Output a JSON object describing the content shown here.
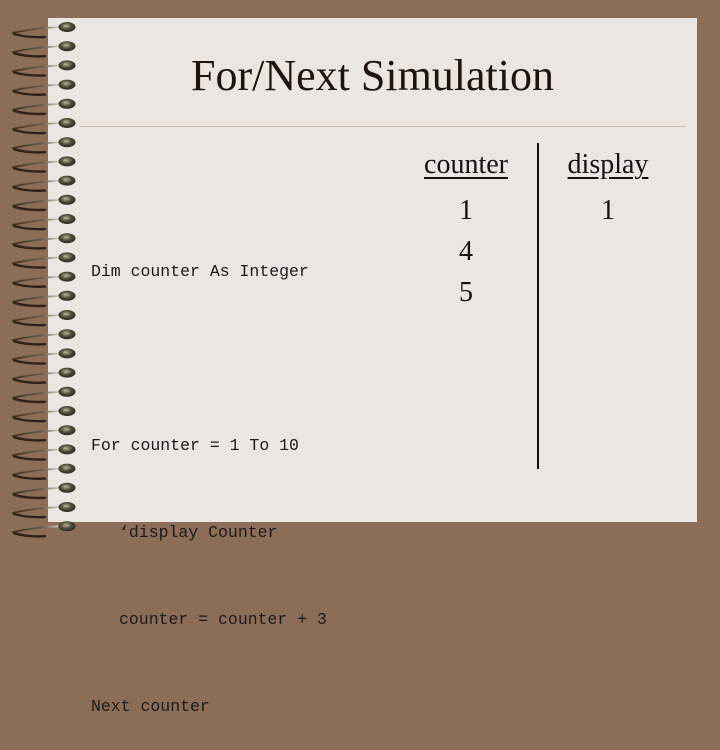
{
  "slide": {
    "title": "For/Next Simulation",
    "code_lines": [
      {
        "text": "Dim counter As Integer",
        "indent": false
      },
      {
        "text": "",
        "indent": false
      },
      {
        "text": "For counter = 1 To 10",
        "indent": false
      },
      {
        "text": "‘display Counter",
        "indent": true
      },
      {
        "text": "counter = counter + 3",
        "indent": true
      },
      {
        "text": "Next counter",
        "indent": false
      }
    ],
    "trace_table": {
      "columns": [
        {
          "header": "counter",
          "values": [
            "1",
            "4",
            "5"
          ]
        },
        {
          "header": "display",
          "values": [
            "1"
          ]
        }
      ]
    }
  },
  "decor": {
    "spiral_icon": "spiral-binding-icon",
    "ring_count": 27
  },
  "colors": {
    "background": "#8c6d58",
    "paper": "#ebe6e1",
    "title_rule": "#c9b8a0"
  }
}
